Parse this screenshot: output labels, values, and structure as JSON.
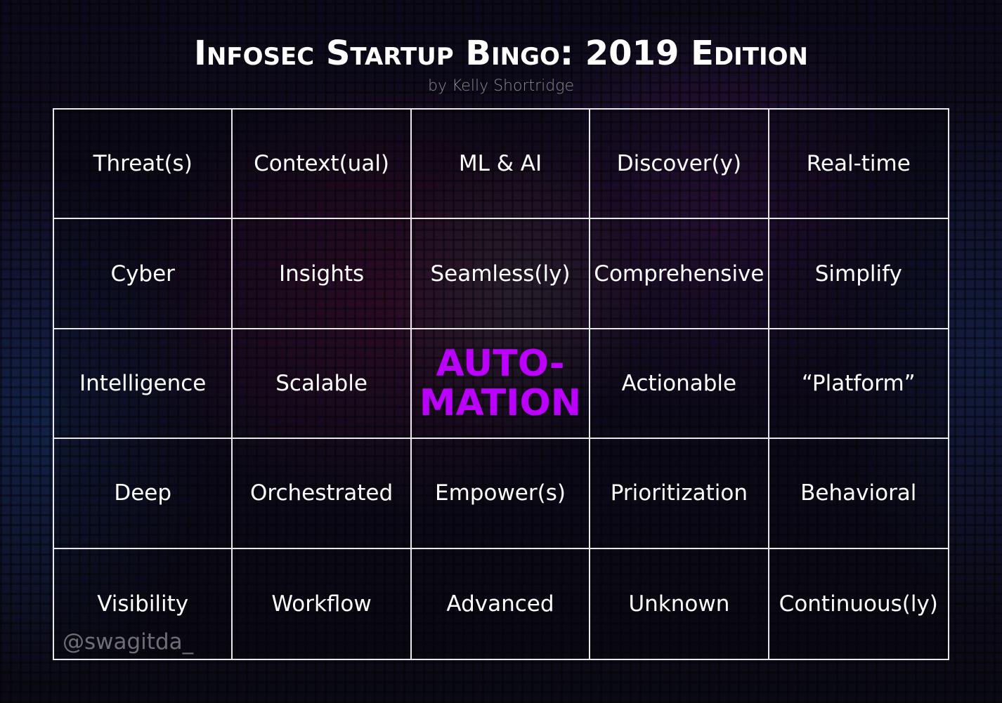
{
  "header": {
    "title": "Infosec Startup Bingo: 2019 Edition",
    "subtitle": "by Kelly Shortridge"
  },
  "colors": {
    "free_cell": "#bb00ff",
    "text": "#ffffff",
    "grid_lines": "#e8e8e8"
  },
  "board": {
    "rows": [
      [
        "Threat(s)",
        "Context(ual)",
        "ML & AI",
        "Discover(y)",
        "Real-time"
      ],
      [
        "Cyber",
        "Insights",
        "Seamless(ly)",
        "Comprehensive",
        "Simplify"
      ],
      [
        "Intelligence",
        "Scalable",
        "AUTO-\nMATION",
        "Actionable",
        "“Platform”"
      ],
      [
        "Deep",
        "Orchestrated",
        "Empower(s)",
        "Prioritization",
        "Behavioral"
      ],
      [
        "Visibility",
        "Workflow",
        "Advanced",
        "Unknown",
        "Continuous(ly)"
      ]
    ],
    "free_space": {
      "row": 2,
      "col": 2
    }
  },
  "watermark": "@swagitda_"
}
